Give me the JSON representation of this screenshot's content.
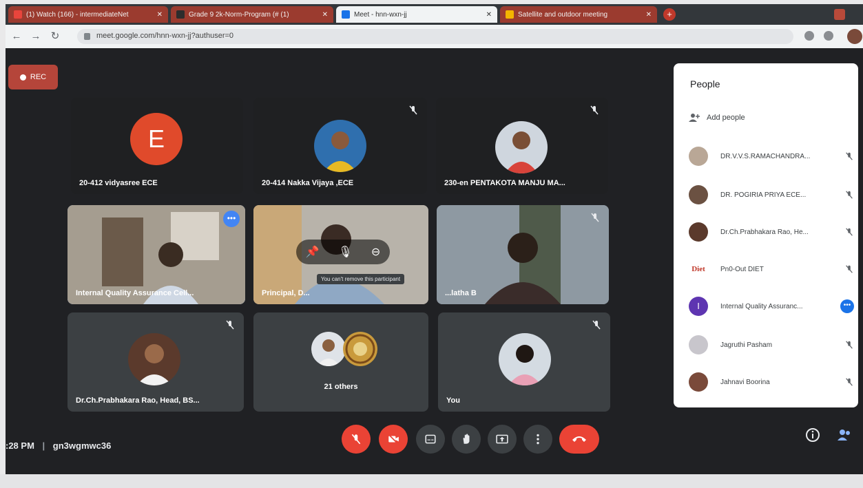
{
  "browser": {
    "tabs": [
      {
        "title": "(1) Watch (166) - intermediateNet",
        "color": "#c0392b"
      },
      {
        "title": "Grade 9 2k-Norm-Program (# (1)",
        "color": "#5f6368"
      },
      {
        "title": "Meet - hnn-wxn-jj",
        "color": "#1a73e8"
      },
      {
        "title": "Satellite and outdoor meeting",
        "color": "#c0392b"
      }
    ],
    "new_tab": "+",
    "url": "meet.google.com/hnn-wxn-jj?authuser=0"
  },
  "meet": {
    "rec_label": "REC",
    "tiles": [
      {
        "name": "20-412 vidyasree ECE",
        "avatar_letter": "E"
      },
      {
        "name": "20-414 Nakka Vijaya ,ECE"
      },
      {
        "name": "230-en PENTAKOTA MANJU MA..."
      },
      {
        "name": "Internal Quality Assurance Cell..."
      },
      {
        "name": "Principal, D...",
        "tooltip": "You can't remove this participant"
      },
      {
        "name": "...latha B"
      },
      {
        "name": "Dr.Ch.Prabhakara Rao, Head, BS..."
      },
      {
        "name": "21 others"
      },
      {
        "name": "You"
      }
    ],
    "time": ":28 PM",
    "separator": "|",
    "meeting_code": "gn3wgmwc36"
  },
  "people": {
    "title": "People",
    "add_people": "Add people",
    "list": [
      {
        "name": "DR.V.V.S.RAMACHANDRA..."
      },
      {
        "name": "DR. POGIRIA PRIYA ECE..."
      },
      {
        "name": "Dr.Ch.Prabhakara Rao, He..."
      },
      {
        "name": "Pn0-Out DIET",
        "logo_text": "Diet"
      },
      {
        "name": "Internal Quality Assuranc...",
        "avatar_letter": "I"
      },
      {
        "name": "Jagruthi Pasham"
      },
      {
        "name": "Jahnavi Boorina"
      }
    ]
  },
  "colors": {
    "meet_bg": "#202124",
    "tile_bg": "#3c4043",
    "accent_red": "#ea4335",
    "accent_blue": "#1a73e8"
  },
  "icons": [
    "mic-off-icon",
    "video-off-icon",
    "captions-icon",
    "raise-hand-icon",
    "present-icon",
    "more-icon",
    "end-call-icon",
    "info-icon",
    "people-icon"
  ]
}
